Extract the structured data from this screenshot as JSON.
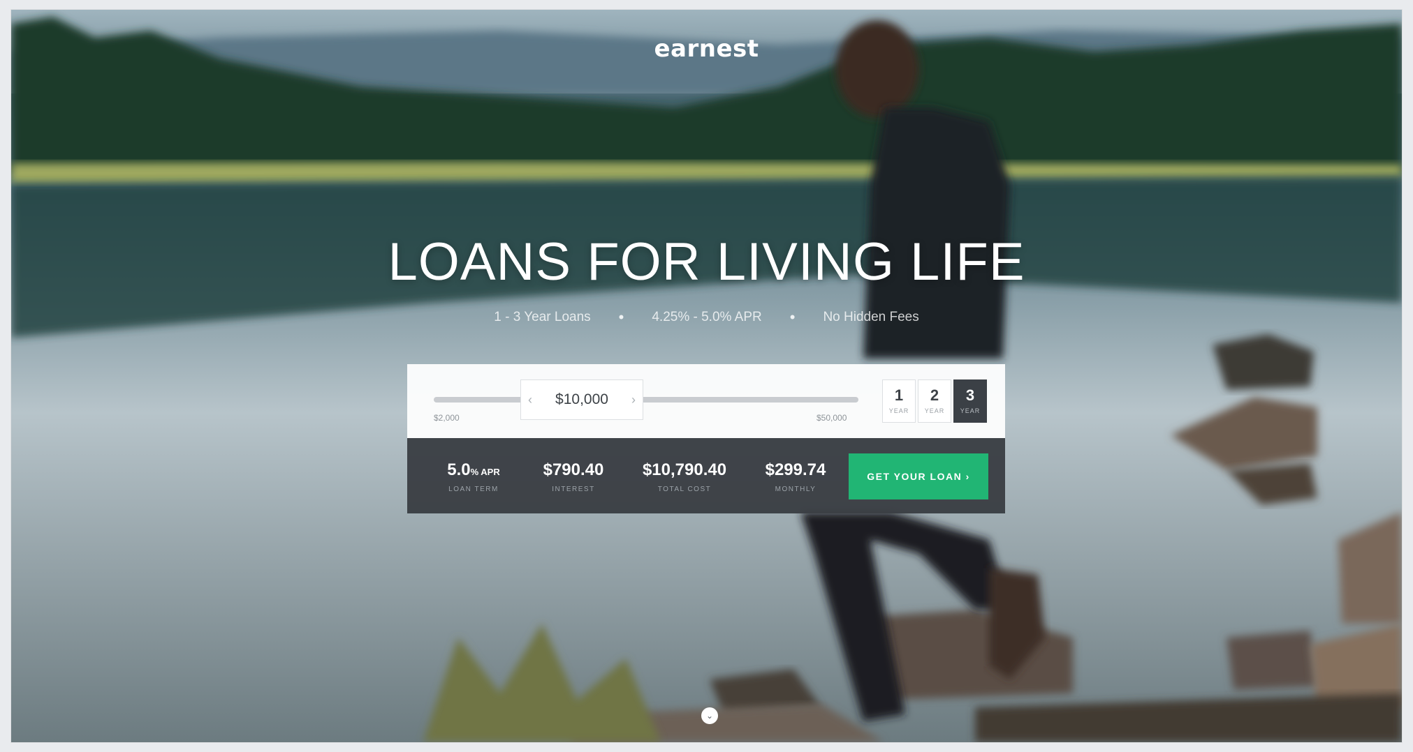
{
  "brand": {
    "logo_text": "earnest"
  },
  "hero": {
    "headline": "LOANS FOR LIVING LIFE",
    "features": [
      "1 - 3 Year Loans",
      "4.25% - 5.0% APR",
      "No Hidden Fees"
    ],
    "separator": "•"
  },
  "calculator": {
    "amount": "$10,000",
    "amount_min": "$2,000",
    "amount_max": "$50,000",
    "amount_fraction": 0.17,
    "prev_arrow": "‹",
    "next_arrow": "›",
    "years": [
      {
        "num": "1",
        "unit": "YEAR",
        "active": false
      },
      {
        "num": "2",
        "unit": "YEAR",
        "active": false
      },
      {
        "num": "3",
        "unit": "YEAR",
        "active": true
      }
    ],
    "stats": [
      {
        "value": "5.0",
        "suffix": "% APR",
        "label": "LOAN TERM"
      },
      {
        "value": "$790.40",
        "suffix": "",
        "label": "INTEREST"
      },
      {
        "value": "$10,790.40",
        "suffix": "",
        "label": "TOTAL COST"
      },
      {
        "value": "$299.74",
        "suffix": "",
        "label": "MONTHLY"
      }
    ],
    "cta_label": "GET YOUR LOAN ›"
  },
  "scroll_icon": "chevron-down-icon",
  "scroll_glyph": "⌄",
  "colors": {
    "accent_green": "#21b574",
    "panel_dark": "#3a3e44"
  }
}
